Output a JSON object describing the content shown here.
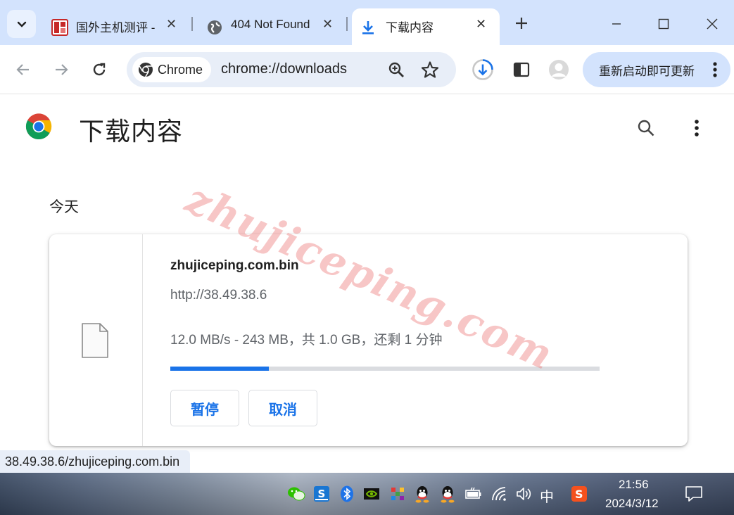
{
  "tabs": [
    {
      "title": "国外主机测评 -",
      "active": false
    },
    {
      "title": "404 Not Found",
      "active": false
    },
    {
      "title": "下载内容",
      "active": true
    }
  ],
  "omnibox": {
    "chip_label": "Chrome",
    "url": "chrome://downloads"
  },
  "toolbar": {
    "update_label": "重新启动即可更新"
  },
  "page": {
    "title": "下载内容",
    "date_group": "今天"
  },
  "download": {
    "file_name": "zhujiceping.com.bin",
    "source_url": "http://38.49.38.6",
    "status": "12.0 MB/s - 243 MB，共 1.0 GB，还剩 1 分钟",
    "progress_fraction": 0.23,
    "pause_label": "暂停",
    "cancel_label": "取消"
  },
  "watermark": "zhujiceping.com",
  "status_bar": {
    "link": "38.49.38.6/zhujiceping.com.bin"
  },
  "taskbar": {
    "ime": "中",
    "time": "21:56",
    "date": "2024/3/12"
  },
  "colors": {
    "accent": "#1a73e8",
    "tab_strip": "#d3e3fd",
    "update_button": "#d3e3fd"
  }
}
